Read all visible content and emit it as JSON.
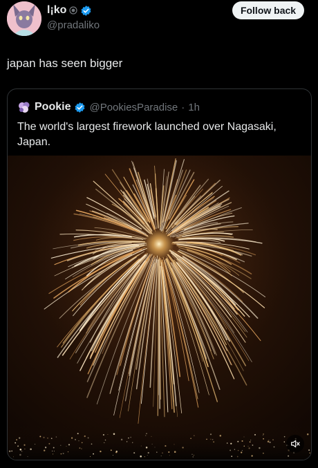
{
  "author": {
    "display_name": "l¡ko",
    "handle": "@pradaliko",
    "follow_label": "Follow back"
  },
  "post": {
    "text": "japan has seen bigger"
  },
  "quoted": {
    "display_name": "Pookie",
    "handle": "@PookiesParadise",
    "separator": "·",
    "time": "1h",
    "text": "The world's largest firework launched over Nagasaki, Japan."
  },
  "media": {
    "mute_icon": "volume-muted-icon"
  },
  "colors": {
    "verified": "#1d9bf0",
    "background": "#000000",
    "secondary_text": "#71767b"
  }
}
